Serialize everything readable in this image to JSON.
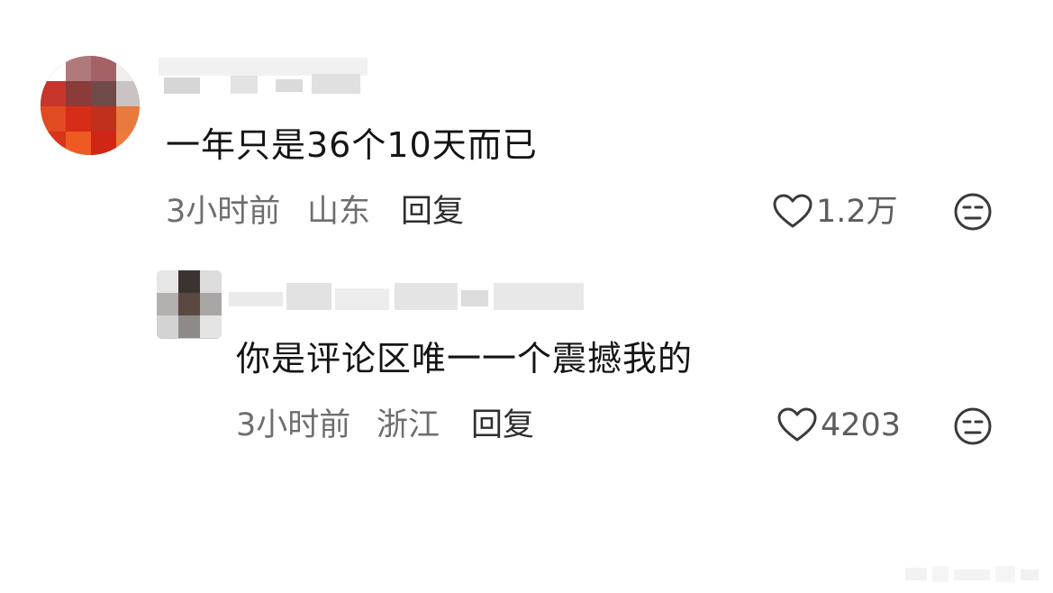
{
  "comments": [
    {
      "text": "一年只是36个10天而已",
      "time": "3小时前",
      "location": "山东",
      "reply_label": "回复",
      "likes": "1.2万"
    },
    {
      "text": "你是评论区唯一一个震撼我的",
      "time": "3小时前",
      "location": "浙江",
      "reply_label": "回复",
      "likes": "4203"
    }
  ],
  "icons": {
    "like": "heart-outline-icon",
    "dislike": "meh-face-icon"
  },
  "colors": {
    "text": "#141414",
    "meta": "#6e6e6e",
    "icon": "#3a3a3a"
  }
}
